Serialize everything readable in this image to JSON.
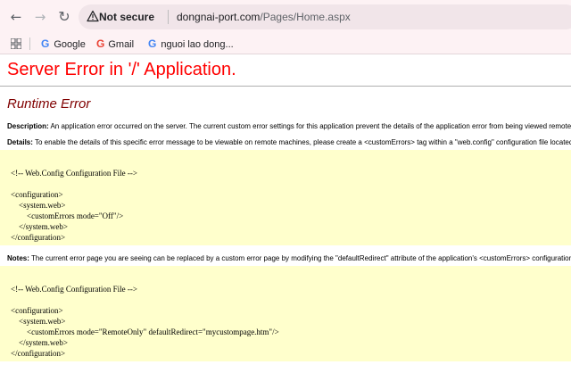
{
  "browser": {
    "security_label": "Not secure",
    "url_host": "dongnai-port.com",
    "url_path": "/Pages/Home.aspx",
    "bookmarks": [
      "Google",
      "Gmail",
      "nguoi lao dong..."
    ]
  },
  "page": {
    "title": "Server Error in '/' Application.",
    "subtitle": "Runtime Error",
    "description_label": "Description:",
    "description_text": " An application error occurred on the server. The current custom error settings for this application prevent the details of the application error from being viewed remotely (for security reasons).",
    "details_label": "Details:",
    "details_text": " To enable the details of this specific error message to be viewable on remote machines, please create a <customErrors> tag within a \"web.config\" configuration file located in the root directory of the current web application.",
    "notes_label": "Notes:",
    "notes_text": " The current error page you are seeing can be replaced by a custom error page by modifying the \"defaultRedirect\" attribute of the application's <customErrors> configuration tag to point to a custom error page URL.",
    "code1": [
      "<!-- Web.Config Configuration File -->",
      "<configuration>",
      "    <system.web>",
      "        <customErrors mode=\"Off\"/>",
      "    </system.web>",
      "</configuration>"
    ],
    "code2": [
      "<!-- Web.Config Configuration File -->",
      "<configuration>",
      "    <system.web>",
      "        <customErrors mode=\"RemoteOnly\" defaultRedirect=\"mycustompage.htm\"/>",
      "    </system.web>",
      "</configuration>"
    ]
  }
}
